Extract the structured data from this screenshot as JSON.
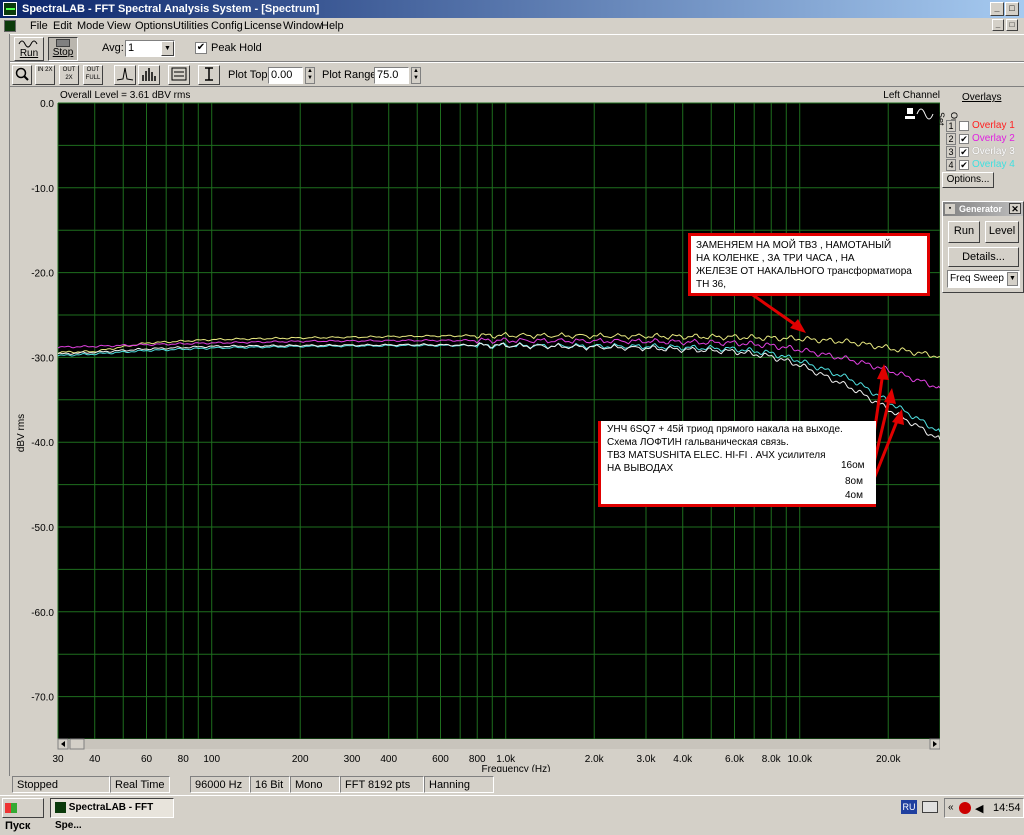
{
  "window": {
    "title": "SpectraLAB - FFT Spectral Analysis System - [Spectrum]"
  },
  "menu": [
    "File",
    "Edit",
    "Mode",
    "View",
    "Options",
    "Utilities",
    "Config",
    "License",
    "Window",
    "Help"
  ],
  "toolbar1": {
    "run_label": "Run",
    "stop_label": "Stop",
    "avg_label": "Avg:",
    "avg_value": "1",
    "peak_hold_label": "Peak Hold",
    "peak_hold_checked": "✔"
  },
  "toolbar2": {
    "in2x_label": "IN 2X",
    "out2x_label": "OUT 2X",
    "outfull_label": "OUT FULL",
    "plot_top_label": "Plot Top:",
    "plot_top_value": "0.00",
    "plot_range_label": "Plot Range:",
    "plot_range_value": "75.0"
  },
  "plot": {
    "overall_level": "Overall Level = 3.61 dBV rms",
    "channel": "Left Channel"
  },
  "overlays": {
    "title": "Overlays",
    "set_label": "Set",
    "on_label": "On",
    "items": [
      {
        "num": "1",
        "check": "",
        "label": "Overlay 1",
        "color": "#ff2020"
      },
      {
        "num": "2",
        "check": "✔",
        "label": "Overlay 2",
        "color": "#e020e0"
      },
      {
        "num": "3",
        "check": "✔",
        "label": "Overlay 3",
        "color": "#ffffff"
      },
      {
        "num": "4",
        "check": "✔",
        "label": "Overlay 4",
        "color": "#40e0e0"
      }
    ],
    "options_label": "Options..."
  },
  "generator": {
    "title": "Generator",
    "run_label": "Run",
    "level_label": "Level",
    "details_label": "Details...",
    "mode": "Freq Sweep"
  },
  "annotations": {
    "top_note": [
      "ЗАМЕНЯЕМ  НА  МОЙ  ТВЗ , НАМОТАНЫЙ",
      "НА  КОЛЕНКЕ ,  ЗА  ТРИ  ЧАСА ,  НА",
      "ЖЕЛЕЗЕ  ОТ  НАКАЛЬНОГО  трансформатиора",
      "ТН 36,"
    ],
    "bottom_note": [
      "УНЧ  6SQ7  + 45й триод прямого накала на выходе.",
      "Схема  ЛОФТИН  гальваническая  связь.",
      " ТВЗ   MATSUSHITA  ELEC. HI-FI .   АЧХ  усилителя",
      " НА  ВЫВОДАХ"
    ],
    "label_16": "16ом",
    "label_8": "8ом",
    "label_4": "4ом"
  },
  "status": [
    "Stopped",
    "Real Time",
    "96000 Hz",
    "16 Bit",
    "Mono",
    "FFT 8192 pts",
    "Hanning"
  ],
  "taskbar": {
    "start_label": "Пуск",
    "task_label": "SpectraLAB - FFT Spe...",
    "lang": "RU",
    "clock": "14:54"
  },
  "chart_data": {
    "type": "line",
    "xlabel": "Frequency (Hz)",
    "ylabel": "dBV rms",
    "xscale": "log",
    "xlim": [
      30,
      30000
    ],
    "ylim": [
      -75,
      0
    ],
    "y_ticks": [
      "0.0",
      "-10.0",
      "-20.0",
      "-30.0",
      "-40.0",
      "-50.0",
      "-60.0",
      "-70.0"
    ],
    "y_tick_values": [
      0,
      -10,
      -20,
      -30,
      -40,
      -50,
      -60,
      -70
    ],
    "x_tick_labels": [
      "30",
      "40",
      "60",
      "80",
      "100",
      "200",
      "300",
      "400",
      "600",
      "800",
      "1.0k",
      "2.0k",
      "3.0k",
      "4.0k",
      "6.0k",
      "8.0k",
      "10.0k",
      "20.0k"
    ],
    "x_tick_values": [
      30,
      40,
      60,
      80,
      100,
      200,
      300,
      400,
      600,
      800,
      1000,
      2000,
      3000,
      4000,
      6000,
      8000,
      10000,
      20000
    ],
    "grid": true,
    "background": "#000000",
    "grid_color": "#1e6e1e",
    "series": [
      {
        "color": "#e8e880",
        "x": [
          30,
          40,
          60,
          100,
          200,
          500,
          1000,
          3000,
          6000,
          10000,
          15000,
          20000,
          30000
        ],
        "y": [
          -29.4,
          -29.3,
          -28.3,
          -27.9,
          -27.7,
          -27.5,
          -27.4,
          -27.5,
          -27.6,
          -27.8,
          -28.2,
          -28.9,
          -29.9
        ]
      },
      {
        "color": "#e040e0",
        "x": [
          30,
          40,
          60,
          100,
          200,
          500,
          1000,
          3000,
          6000,
          8000,
          10000,
          15000,
          20000,
          30000
        ],
        "y": [
          -28.8,
          -28.7,
          -28.5,
          -28.3,
          -28.1,
          -28.0,
          -28.0,
          -28.1,
          -28.3,
          -28.6,
          -29.1,
          -30.3,
          -31.5,
          -33.6
        ]
      },
      {
        "color": "#50e0e0",
        "x": [
          30,
          40,
          60,
          100,
          200,
          500,
          1000,
          3000,
          6000,
          8000,
          10000,
          15000,
          20000,
          30000
        ],
        "y": [
          -29.8,
          -29.6,
          -29.2,
          -28.9,
          -28.7,
          -28.6,
          -28.6,
          -28.7,
          -29.0,
          -29.5,
          -30.4,
          -32.6,
          -35.2,
          -38.8
        ]
      },
      {
        "color": "#f0f0f0",
        "x": [
          30,
          40,
          60,
          100,
          200,
          500,
          1000,
          3000,
          6000,
          8000,
          10000,
          15000,
          20000,
          30000
        ],
        "y": [
          -29.6,
          -29.4,
          -29.0,
          -28.7,
          -28.6,
          -28.5,
          -28.6,
          -28.9,
          -29.3,
          -29.9,
          -30.9,
          -33.6,
          -36.1,
          -39.7
        ]
      }
    ]
  }
}
